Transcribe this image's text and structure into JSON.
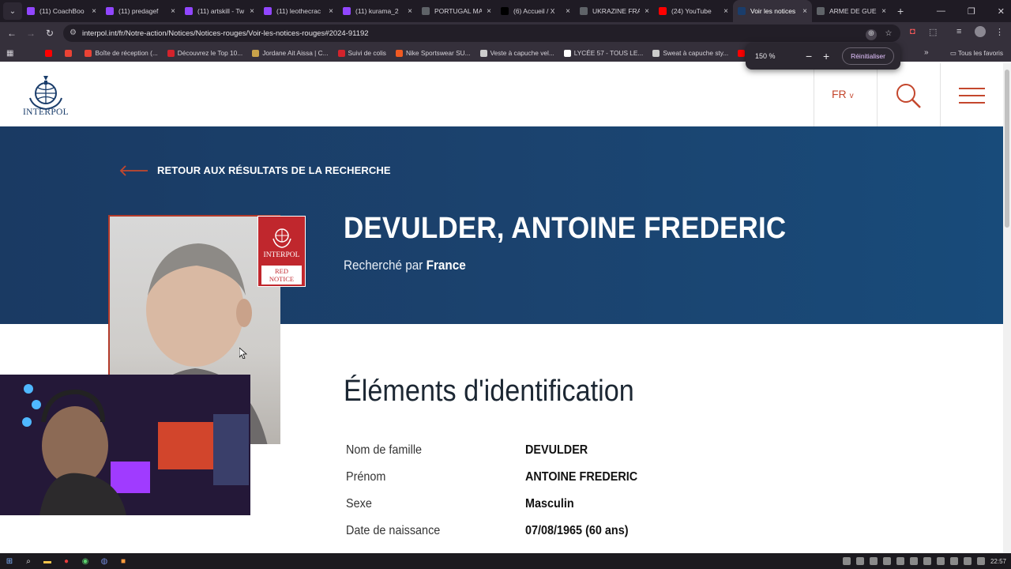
{
  "browser": {
    "tabs": [
      {
        "label": "(11) CoachBoo",
        "color": "#9146ff"
      },
      {
        "label": "(11) predagef",
        "color": "#9146ff"
      },
      {
        "label": "(11) artskill - Tw",
        "color": "#9146ff"
      },
      {
        "label": "(11) leothecrac",
        "color": "#9146ff"
      },
      {
        "label": "(11) kurama_2",
        "color": "#9146ff"
      },
      {
        "label": "PORTUGAL MA",
        "color": "#5f6368"
      },
      {
        "label": "(6) Accueil / X",
        "color": "#000000"
      },
      {
        "label": "UKRAZINE FRA",
        "color": "#5f6368"
      },
      {
        "label": "(24) YouTube",
        "color": "#ff0000"
      },
      {
        "label": "Voir les notices",
        "color": "#1a3d6b"
      },
      {
        "label": "ARME DE GUE",
        "color": "#5f6368"
      }
    ],
    "active_tab_index": 9,
    "url": "interpol.int/fr/Notre-action/Notices/Notices-rouges/Voir-les-notices-rouges#2024-91192",
    "bookmarks": [
      {
        "label": "",
        "color": "#ff0000"
      },
      {
        "label": "",
        "color": "#ea4335"
      },
      {
        "label": "Boîte de réception (...",
        "color": "#ea4335"
      },
      {
        "label": "Découvrez le Top 10...",
        "color": "#d4232c"
      },
      {
        "label": "Jordane Ait Aissa | C...",
        "color": "#c8a24a"
      },
      {
        "label": "Suivi de colis",
        "color": "#d4232c"
      },
      {
        "label": "Nike Sportswear SU...",
        "color": "#f05a22"
      },
      {
        "label": "Veste à capuche vel...",
        "color": "#cccccc"
      },
      {
        "label": "LYCÉE 57 - TOUS LE...",
        "color": "#ffffff"
      },
      {
        "label": "Sweat à capuche sty...",
        "color": "#cccccc"
      },
      {
        "label": "(27)",
        "color": "#ff0000"
      },
      {
        "label": "LIV",
        "color": "#ff0000"
      }
    ],
    "all_bookmarks_label": "Tous les favoris",
    "zoom": {
      "value": "150 %",
      "minus": "−",
      "plus": "+",
      "reset_label": "Réinitialiser"
    }
  },
  "site": {
    "logo_text": "INTERPOL",
    "lang": "FR",
    "lang_chevron": "v",
    "back_label": "RETOUR AUX RÉSULTATS DE LA RECHERCHE",
    "person_name": "DEVULDER, ANTOINE FREDERIC",
    "wanted_prefix": "Recherché par",
    "wanted_country": "France",
    "badge_org": "INTERPOL",
    "badge_line1": "RED",
    "badge_line2": "NOTICE",
    "section_title": "Éléments d'identification",
    "fields": [
      {
        "label": "Nom de famille",
        "value": "DEVULDER"
      },
      {
        "label": "Prénom",
        "value": "ANTOINE FREDERIC"
      },
      {
        "label": "Sexe",
        "value": "Masculin"
      },
      {
        "label": "Date de naissance",
        "value": "07/08/1965 (60 ans)"
      }
    ]
  },
  "taskbar": {
    "time": "22:57"
  },
  "colors": {
    "accent": "#c4472d",
    "hero": "#1b436f",
    "badge": "#c0272d"
  }
}
